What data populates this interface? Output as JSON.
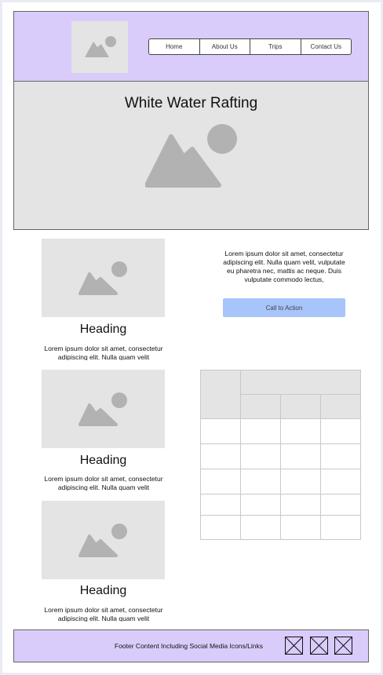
{
  "nav": {
    "items": [
      "Home",
      "About Us",
      "Trips",
      "Contact Us"
    ]
  },
  "hero": {
    "title": "White Water Rafting",
    "image_icon": "image-placeholder-icon"
  },
  "intro": {
    "text": "Lorem ipsum dolor sit amet, consectetur adipiscing elit. Nulla quam velit, vulputate eu pharetra nec, mattis ac neque. Duis vulputate commodo lectus,",
    "cta_label": "Call to Action"
  },
  "cards": [
    {
      "heading": "Heading",
      "text": "Lorem ipsum dolor sit amet, consectetur adipiscing elit. Nulla quam velit"
    },
    {
      "heading": "Heading",
      "text": "Lorem ipsum dolor sit amet, consectetur adipiscing elit. Nulla quam velit"
    },
    {
      "heading": "Heading",
      "text": "Lorem ipsum dolor sit amet, consectetur adipiscing elit. Nulla quam velit"
    }
  ],
  "table": {
    "header_rows": 1,
    "body_rows": 5,
    "columns": 4
  },
  "footer": {
    "text": "Footer Content Including Social Media Icons/Links",
    "social_icons": [
      "social-icon-placeholder",
      "social-icon-placeholder",
      "social-icon-placeholder"
    ]
  },
  "colors": {
    "header_bg": "#d9ccfb",
    "placeholder_bg": "#e4e4e4",
    "placeholder_icon": "#b2b2b2",
    "cta_bg": "#a7c4fb"
  }
}
